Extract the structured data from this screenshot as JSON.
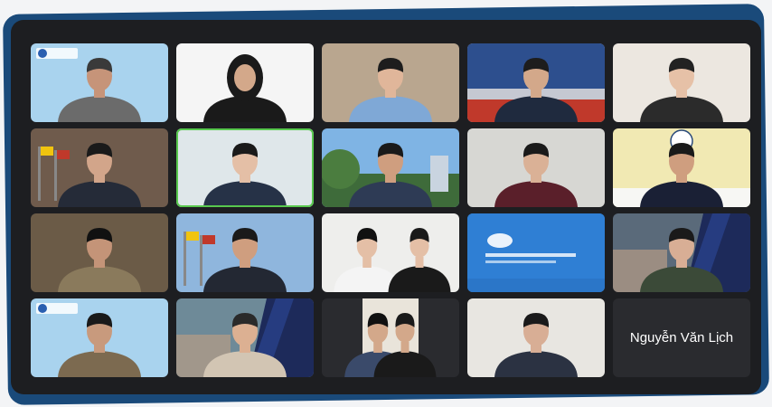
{
  "tiles": [
    {
      "bg": "#a9d3ee",
      "skin": "#c69479",
      "hair": "#3a3a3a",
      "shirt": "#6b6b6b",
      "logo": true
    },
    {
      "bg": "#f5f5f5",
      "skin": "#d3a88a",
      "hair": "#1a1a1a",
      "shirt": "#1a1a1a",
      "hijab": true
    },
    {
      "bg": "#b9a68f",
      "skin": "#e0b69a",
      "hair": "#1d1d1d",
      "shirt": "#7fa8d6"
    },
    {
      "bg": "#c5c8d2",
      "skin": "#d3a88a",
      "hair": "#1d1d1d",
      "shirt": "#1f2a3e",
      "meeting": true
    },
    {
      "bg": "#ece7e0",
      "skin": "#e6c1a7",
      "hair": "#222",
      "shirt": "#2b2b2b"
    },
    {
      "bg": "#6f5b4c",
      "skin": "#d2a58a",
      "hair": "#1a1a1a",
      "shirt": "#252b38",
      "flags": true
    },
    {
      "bg": "#dfe7ea",
      "skin": "#e4bfa6",
      "hair": "#1a1a1a",
      "shirt": "#263247",
      "active": true
    },
    {
      "bg": "#7fb4e4",
      "skin": "#cf9e7f",
      "hair": "#1a1a1a",
      "shirt": "#2e3b55",
      "trees": true
    },
    {
      "bg": "#d7d7d3",
      "skin": "#dab196",
      "hair": "#1a1a1a",
      "shirt": "#5a1f2a"
    },
    {
      "bg": "#f1e9b3",
      "skin": "#cf9e7f",
      "hair": "#1a1a1a",
      "shirt": "#1a2035",
      "desk": true
    },
    {
      "bg": "#6b5b47",
      "skin": "#c49478",
      "hair": "#111",
      "shirt": "#8a7a5c"
    },
    {
      "bg": "#8fb6dd",
      "skin": "#cf9e7f",
      "hair": "#1a1a1a",
      "shirt": "#232833",
      "flags": true
    },
    {
      "bg": "#eeeeec",
      "skin": "#e4bfa6",
      "hair": "#111",
      "shirt": "#f4f4f4",
      "pair": true
    },
    {
      "bg": "#2f7fd4",
      "skin": null,
      "screen": true
    },
    {
      "bg": "#5a6a7a",
      "skin": "#d8ae95",
      "hair": "#1a1a1a",
      "shirt": "#3b4a38",
      "slide": true
    },
    {
      "bg": "#a9d3ee",
      "skin": "#c89a7d",
      "hair": "#1a1a1a",
      "shirt": "#7c6a50",
      "logo": true
    },
    {
      "bg": "#6e8a98",
      "skin": "#dcb092",
      "hair": "#2a2a2a",
      "shirt": "#d2c5b3",
      "slide": true
    },
    {
      "bg": "#2a2b2f",
      "skin": "#d3a88a",
      "hair": "#111",
      "shirt": "#3a4a6a",
      "pair": true,
      "narrow": true
    },
    {
      "bg": "#e8e6e1",
      "skin": "#d8ae95",
      "hair": "#1a1a1a",
      "shirt": "#2b3242"
    },
    {
      "bg": "#2a2b2f",
      "nameOnly": true,
      "name": "Nguyễn Văn Lịch"
    }
  ]
}
